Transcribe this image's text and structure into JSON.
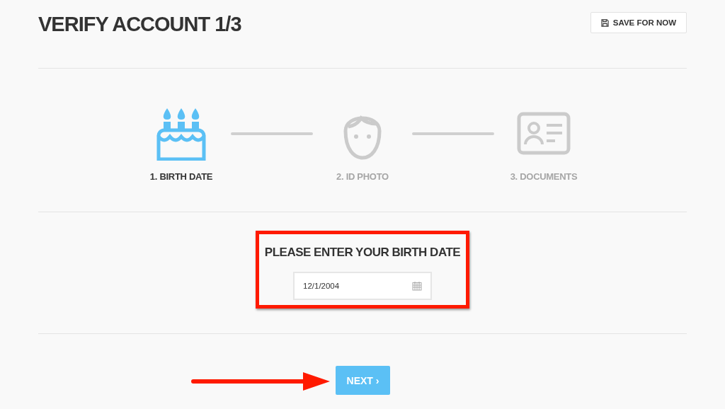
{
  "title": "VERIFY ACCOUNT 1/3",
  "save_button": {
    "label": "SAVE FOR NOW"
  },
  "steps": [
    {
      "kind": "cake",
      "label": "1. BIRTH DATE",
      "selected": true
    },
    {
      "kind": "face",
      "label": "2. ID PHOTO",
      "selected": false
    },
    {
      "kind": "id-card",
      "label": "3. DOCUMENTS",
      "selected": false
    }
  ],
  "form": {
    "heading": "PLEASE ENTER YOUR BIRTH DATE",
    "date_field": {
      "value": "12/1/2004"
    },
    "highlighted": true
  },
  "next_button": {
    "label": "NEXT ›"
  },
  "annotation_arrow": true
}
